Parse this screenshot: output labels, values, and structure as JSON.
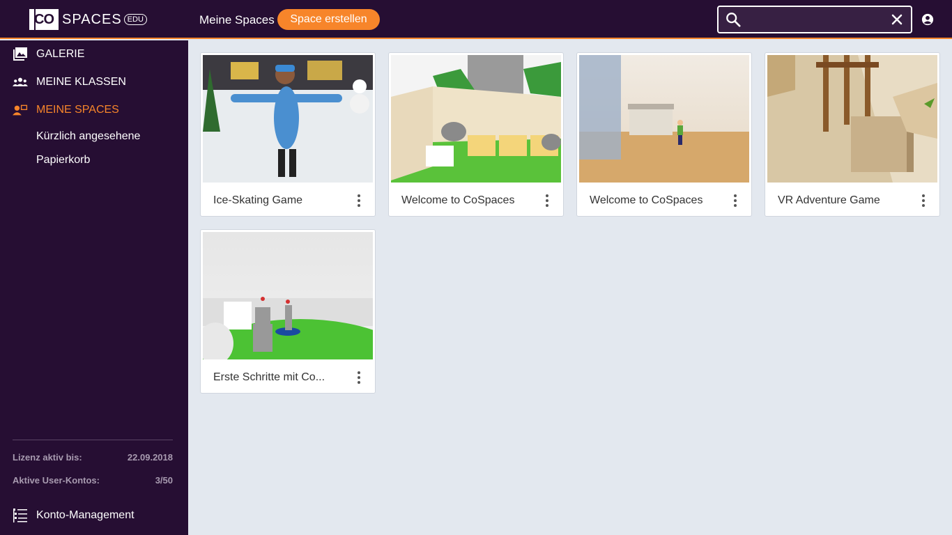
{
  "header": {
    "logo_co": "CO",
    "logo_spaces": "SPACES",
    "logo_edu": "EDU",
    "nav_my_spaces": "Meine Spaces",
    "create_button": "Space erstellen",
    "search_value": "",
    "search_icon": "search-icon",
    "clear_icon": "close-icon",
    "user_icon": "account-icon"
  },
  "sidebar": {
    "items": [
      {
        "label": "GALERIE",
        "icon": "gallery-icon"
      },
      {
        "label": "MEINE KLASSEN",
        "icon": "classes-icon"
      },
      {
        "label": "MEINE SPACES",
        "icon": "spaces-icon",
        "active": true
      }
    ],
    "sub_items": [
      {
        "label": "Kürzlich angesehene"
      },
      {
        "label": "Papierkorb"
      }
    ],
    "license_label": "Lizenz aktiv bis:",
    "license_value": "22.09.2018",
    "accounts_label": "Aktive User-Kontos:",
    "accounts_value": "3/50",
    "account_mgmt": "Konto-Management"
  },
  "cards": [
    {
      "title": "Ice-Skating Game",
      "thumb": "ice-skating"
    },
    {
      "title": "Welcome to CoSpaces",
      "thumb": "welcome-green"
    },
    {
      "title": "Welcome to CoSpaces",
      "thumb": "desert"
    },
    {
      "title": "VR Adventure Game",
      "thumb": "adventure"
    },
    {
      "title": "Erste Schritte mit Co...",
      "thumb": "robots"
    }
  ],
  "colors": {
    "header_bg": "#260e33",
    "accent": "#f7852a",
    "content_bg": "#e3e8ef"
  }
}
